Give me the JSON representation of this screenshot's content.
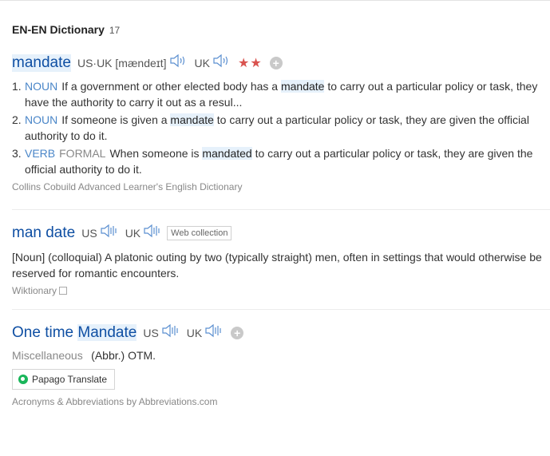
{
  "section": {
    "title": "EN-EN Dictionary",
    "count": "17"
  },
  "entry1": {
    "word": "mandate",
    "pron": "US·UK [mændeɪt]",
    "uk_label": "UK",
    "stars": "★★",
    "plus": "+",
    "defs": [
      {
        "num": "1.",
        "pos": "NOUN",
        "pre": "If a government or other elected body has a ",
        "kw": "mandate",
        "post": " to carry out a particular policy or task, they have the authority to carry it out as a resul..."
      },
      {
        "num": "2.",
        "pos": "NOUN",
        "pre": "If someone is given a ",
        "kw": "mandate",
        "post": " to carry out a particular policy or task, they are given the official authority to do it."
      },
      {
        "num": "3.",
        "pos": "VERB",
        "reg": "FORMAL",
        "pre": "When someone is ",
        "kw": "mandated",
        "post": " to carry out a particular policy or task, they are given the official authority to do it."
      }
    ],
    "source": "Collins Cobuild Advanced Learner's English Dictionary"
  },
  "entry2": {
    "word": "man date",
    "us_label": "US",
    "uk_label": "UK",
    "badge": "Web collection",
    "definition": "[Noun] (colloquial) A platonic outing by two (typically straight) men, often in settings that would otherwise be reserved for romantic encounters.",
    "source": "Wiktionary"
  },
  "entry3": {
    "word_pre": "One time ",
    "word_hl": "Mandate",
    "us_label": "US",
    "uk_label": "UK",
    "plus": "+",
    "misc_label": "Miscellaneous",
    "misc_value": "(Abbr.) OTM.",
    "translate_label": "Papago Translate",
    "source": "Acronyms & Abbreviations by Abbreviations.com"
  },
  "colors": {
    "link": "#0f4fa3",
    "pos": "#4a86c8",
    "highlight": "#e6f1fb",
    "stars": "#d9534f",
    "papago": "#19b65a"
  },
  "icons": {
    "speaker": "speaker-icon",
    "plus": "plus-circle-icon",
    "copy": "copy-icon",
    "papago": "papago-logo-icon"
  }
}
